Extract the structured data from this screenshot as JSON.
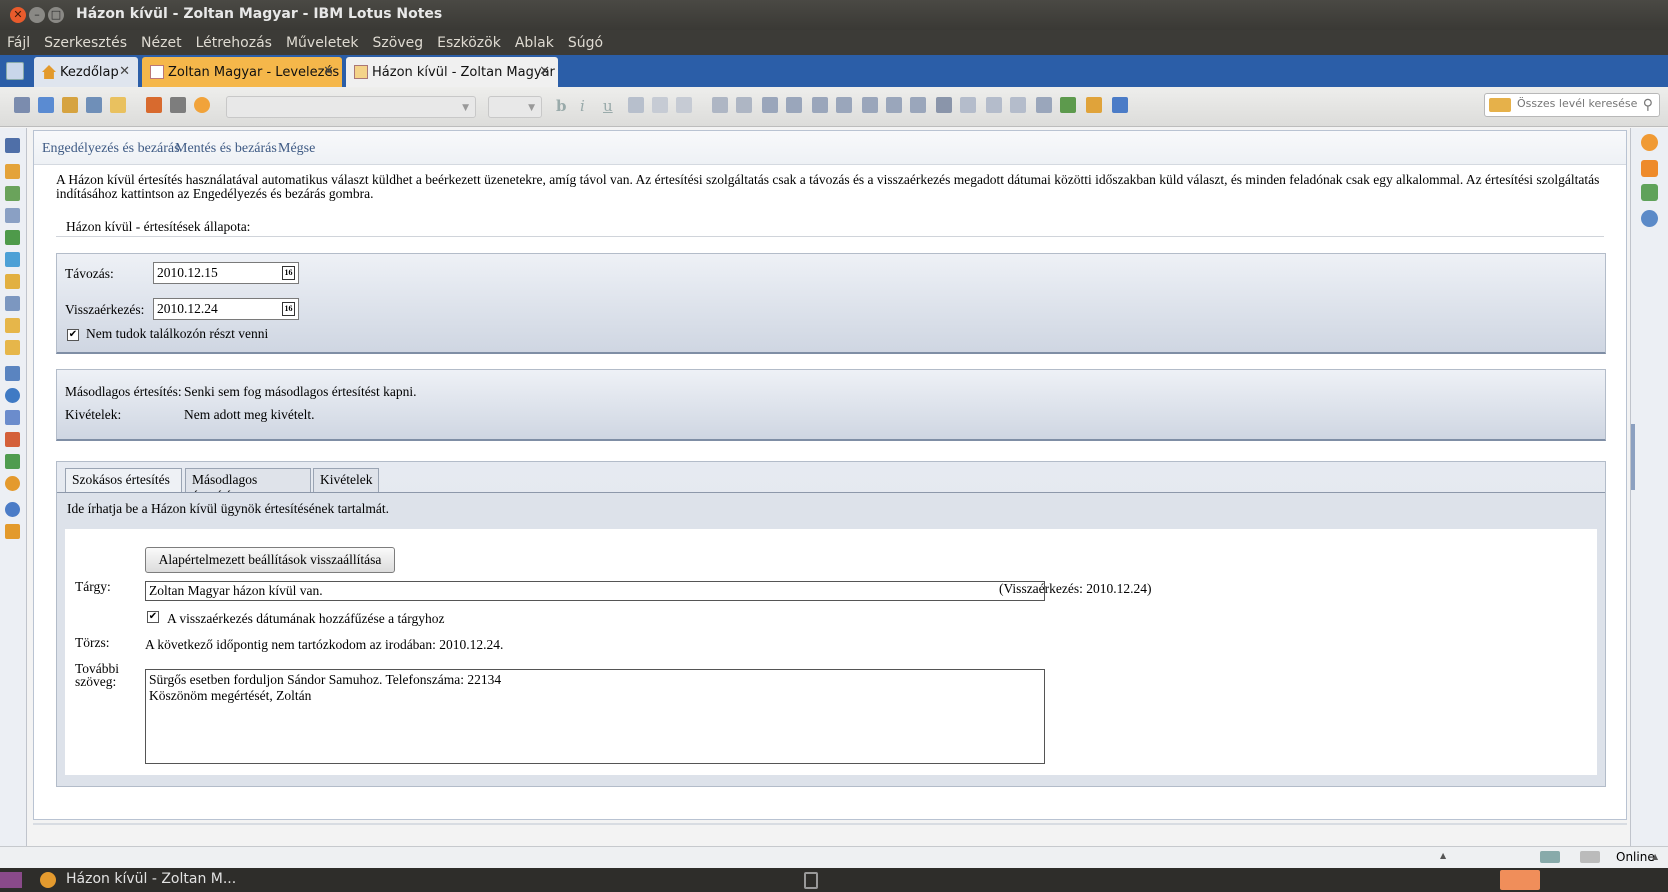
{
  "window": {
    "title": "Házon kívül - Zoltan Magyar - IBM Lotus Notes"
  },
  "menubar": [
    "Fájl",
    "Szerkesztés",
    "Nézet",
    "Létrehozás",
    "Műveletek",
    "Szöveg",
    "Eszközök",
    "Ablak",
    "Súgó"
  ],
  "tabs": [
    {
      "label": "Kezdőlap",
      "icon": "home-icon"
    },
    {
      "label": "Zoltan Magyar - Levelezés",
      "icon": "mail-icon"
    },
    {
      "label": "Házon kívül - Zoltan Magyar",
      "icon": "out-of-office-icon"
    }
  ],
  "toolbar": {
    "search_placeholder": "Összes levél keresése"
  },
  "actions": {
    "enable": "Engedélyezés és bezárás",
    "save": "Mentés és bezárás",
    "cancel": "Mégse"
  },
  "intro": "A Házon kívül értesítés használatával automatikus választ küldhet a beérkezett üzenetekre, amíg távol van. Az értesítési szolgáltatás csak a távozás és a visszaérkezés megadott dátumai közötti időszakban küld választ, és minden feladónak csak egy alkalommal. Az értesítési szolgáltatás indításához kattintson az Engedélyezés és bezárás gombra.",
  "status_label": "Házon kívül - értesítések állapota:",
  "leave": {
    "label": "Távozás:",
    "value": "2010.12.15"
  },
  "return": {
    "label": "Visszaérkezés:",
    "value": "2010.12.24"
  },
  "calendar_glyph": "16",
  "cant_attend": {
    "label": "Nem tudok találkozón részt venni",
    "checked": true
  },
  "secondary": {
    "label": "Másodlagos értesítés:",
    "value": "Senki sem fog másodlagos értesítést kapni."
  },
  "exceptions": {
    "label": "Kivételek:",
    "value": "Nem adott meg kivételt."
  },
  "inner_tabs": [
    "Szokásos értesítés",
    "Másodlagos értesítés",
    "Kivételek"
  ],
  "tab_hint": "Ide írhatja be a Házon kívül ügynök értesítésének tartalmát.",
  "reset_button": "Alapértelmezett beállítások visszaállítása",
  "subject": {
    "label": "Tárgy:",
    "value": "Zoltan Magyar házon kívül van.",
    "suffix": "(Visszaérkezés: 2010.12.24)"
  },
  "append_date": {
    "label": "A visszaérkezés dátumának hozzáfűzése a tárgyhoz",
    "checked": true
  },
  "body": {
    "label": "Törzs:",
    "value": "A következő időpontig nem tartózkodom az irodában: 2010.12.24."
  },
  "extra": {
    "label_line1": "További",
    "label_line2": "szöveg:",
    "line1": "Sürgős esetben forduljon Sándor Samuhoz. Telefonszáma: 22134",
    "line2": "Köszönöm megértését, Zoltán"
  },
  "statusbar": {
    "online": "Online"
  },
  "taskbar": {
    "item": "Házon kívül - Zoltan M..."
  }
}
